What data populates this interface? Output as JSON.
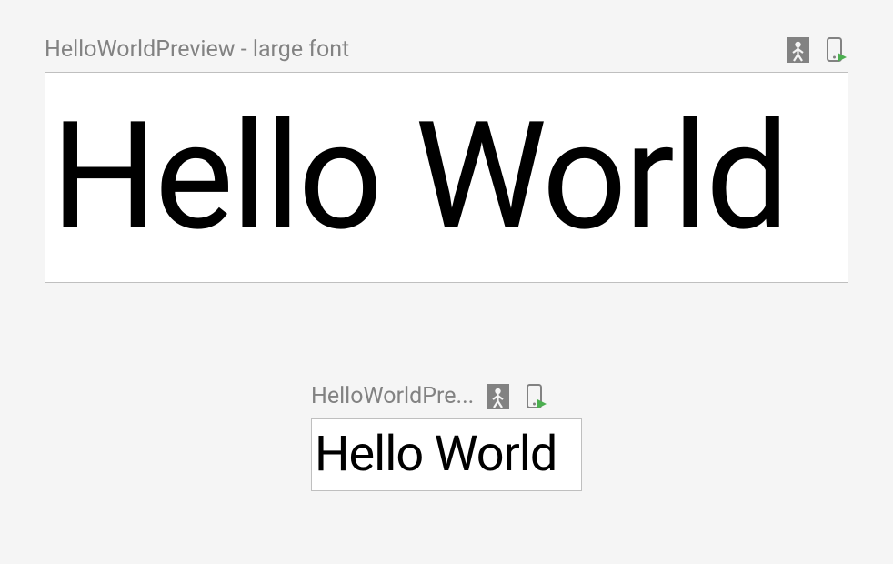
{
  "previews": [
    {
      "title": "HelloWorldPreview - large font",
      "content": "Hello World"
    },
    {
      "title": "HelloWorldPre...",
      "content": "Hello World"
    }
  ]
}
